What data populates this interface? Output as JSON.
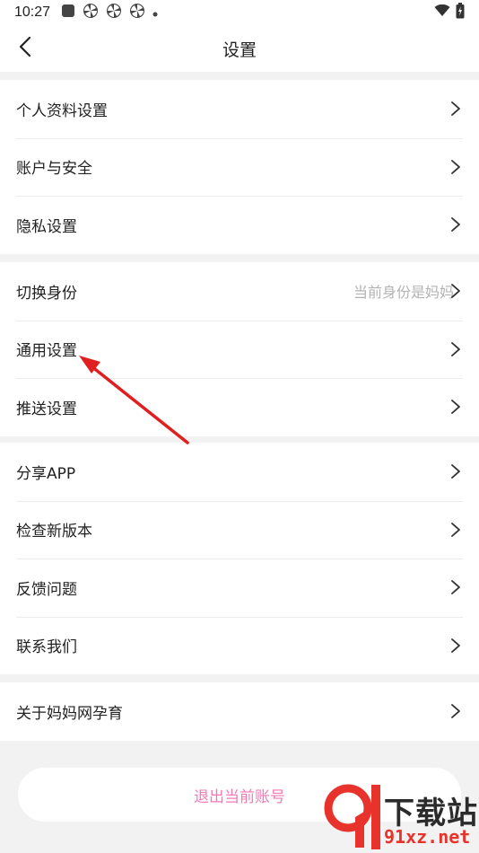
{
  "status_bar": {
    "time": "10:27",
    "icons": [
      "app-square-icon",
      "pinwheel-icon",
      "pinwheel-icon",
      "pinwheel-icon",
      "dot-icon"
    ],
    "right_icons": [
      "wifi-icon",
      "battery-charging-icon"
    ]
  },
  "header": {
    "title": "设置",
    "back_icon": "chevron-left-icon"
  },
  "groups": [
    {
      "items": [
        {
          "label": "个人资料设置"
        },
        {
          "label": "账户与安全"
        },
        {
          "label": "隐私设置"
        }
      ]
    },
    {
      "items": [
        {
          "label": "切换身份",
          "hint": "当前身份是妈妈"
        },
        {
          "label": "通用设置"
        },
        {
          "label": "推送设置"
        }
      ]
    },
    {
      "items": [
        {
          "label": "分享APP"
        },
        {
          "label": "检查新版本"
        },
        {
          "label": "反馈问题"
        },
        {
          "label": "联系我们"
        }
      ]
    },
    {
      "items": [
        {
          "label": "关于妈妈网孕育"
        }
      ]
    }
  ],
  "logout": {
    "label": "退出当前账号"
  },
  "annotation": {
    "type": "red-arrow",
    "color": "#e02020",
    "target": "通用设置"
  },
  "watermark": {
    "logo_text": "下载站",
    "site": "91xz.net",
    "brand_color": "#e8332c"
  }
}
